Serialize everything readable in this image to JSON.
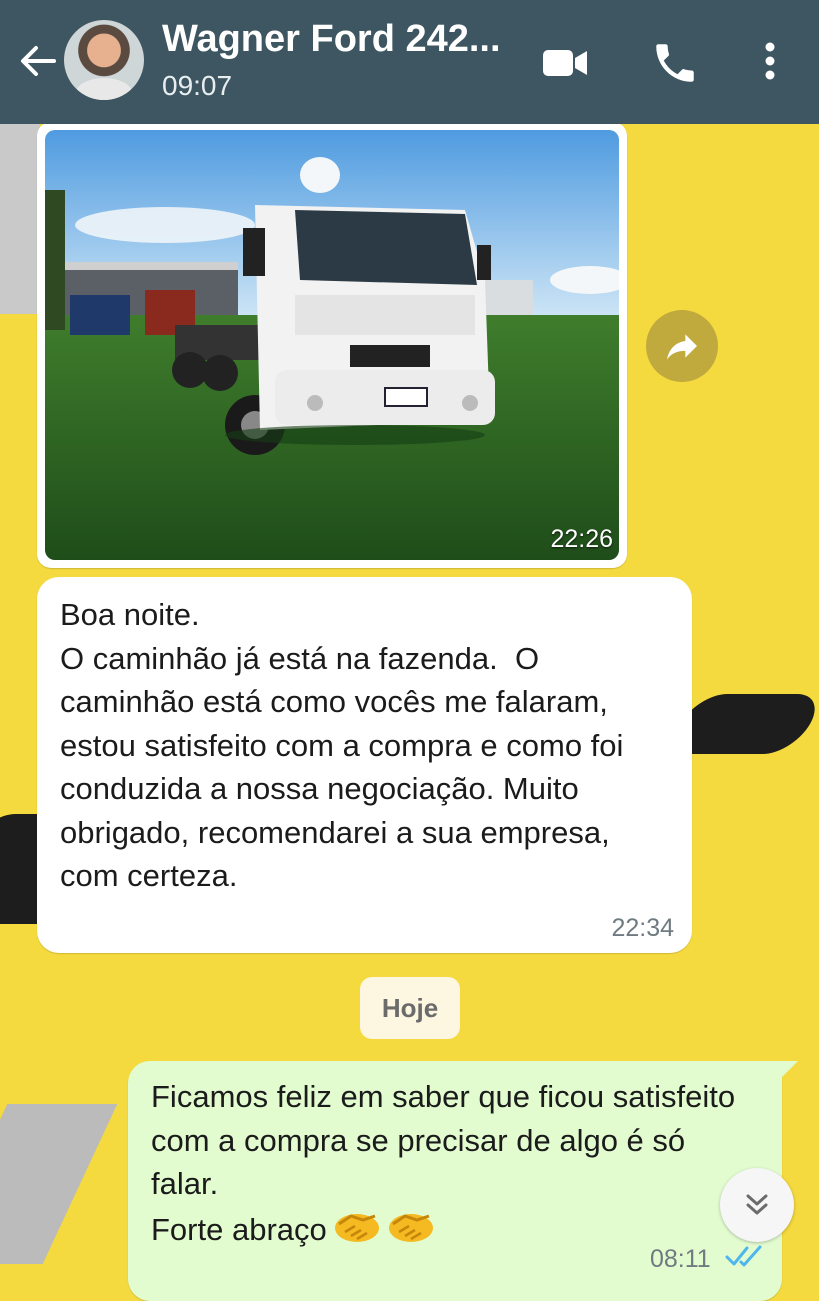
{
  "header": {
    "contact_name": "Wagner Ford 242...",
    "last_seen": "09:07",
    "background": "#3d5661"
  },
  "messages": [
    {
      "type": "image",
      "direction": "incoming",
      "time": "22:26"
    },
    {
      "type": "text",
      "direction": "incoming",
      "time": "22:34",
      "text": "Boa noite.\nO caminhão já está na fazenda.  O caminhão está como vocês me falaram, estou satisfeito com a compra e como foi conduzida a nossa negociação. Muito obrigado, recomendarei a sua empresa, com certeza."
    },
    {
      "type": "date_separator",
      "label": "Hoje"
    },
    {
      "type": "text",
      "direction": "outgoing",
      "time": "08:11",
      "status": "read",
      "text": "Ficamos feliz em saber que ficou satisfeito com a compra se precisar de algo é só  falar.\nForte abraço"
    }
  ],
  "icons": {
    "back": "back-arrow-icon",
    "video": "video-call-icon",
    "call": "phone-icon",
    "menu": "more-vertical-icon",
    "forward": "forward-icon",
    "scroll": "double-chevron-down-icon",
    "ticks": "double-check-icon",
    "emoji": "handshake-emoji"
  },
  "colors": {
    "wallpaper": "#f4d93f",
    "incoming_bubble": "#ffffff",
    "outgoing_bubble": "#e2fcd0",
    "read_ticks": "#4fb6ec"
  }
}
